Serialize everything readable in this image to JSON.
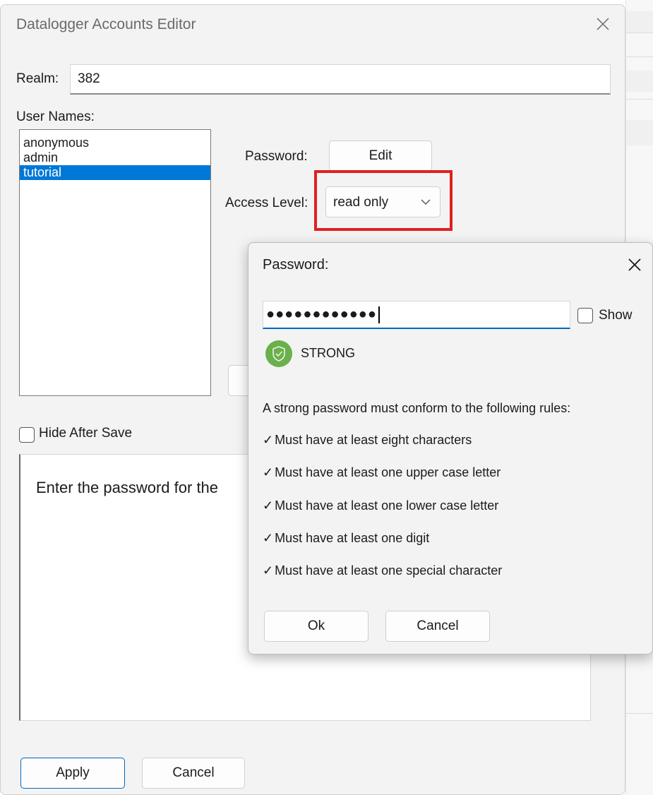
{
  "window": {
    "title": "Datalogger Accounts Editor"
  },
  "realm": {
    "label": "Realm:",
    "value": "382"
  },
  "users": {
    "label": "User Names:",
    "items": [
      {
        "name": "anonymous",
        "selected": false
      },
      {
        "name": "admin",
        "selected": false
      },
      {
        "name": "tutorial",
        "selected": true
      }
    ]
  },
  "password": {
    "label": "Password:",
    "edit_label": "Edit"
  },
  "access": {
    "label": "Access Level:",
    "value": "read only"
  },
  "hide_after_save": {
    "label": "Hide After Save",
    "checked": false
  },
  "info": {
    "text": "Enter the password for the"
  },
  "buttons": {
    "apply": "Apply",
    "cancel": "Cancel"
  },
  "password_dialog": {
    "title": "Password:",
    "masked_value": "●●●●●●●●●●●●",
    "show_label": "Show",
    "show_checked": false,
    "strength": "STRONG",
    "rules_heading": "A strong password must conform to the following rules:",
    "check_mark": "✓",
    "rules": [
      "Must have at least eight characters",
      "Must have at least one upper case letter",
      "Must have at least one lower case letter",
      "Must have at least one digit",
      "Must have at least one special character"
    ],
    "ok_label": "Ok",
    "cancel_label": "Cancel"
  },
  "colors": {
    "selection": "#0078d7",
    "highlight": "#e02020",
    "strength": "#6ab04c",
    "accent": "#0067c0"
  }
}
